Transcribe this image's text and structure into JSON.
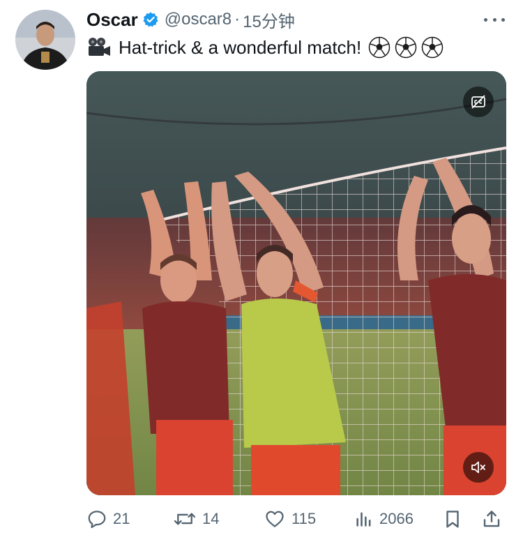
{
  "tweet": {
    "author_name": "Oscar",
    "handle": "@oscar8",
    "separator": "·",
    "time_ago": "15分钟",
    "text": "Hat-trick & a wonderful match!",
    "leading_emoji": "movie-camera-icon",
    "trailing_emoji": [
      "soccer-ball-icon",
      "soccer-ball-icon",
      "soccer-ball-icon"
    ]
  },
  "media": {
    "type": "video",
    "captions_icon": "captions-off-icon",
    "volume_icon": "muted-speaker-icon"
  },
  "actions": {
    "replies": "21",
    "reposts": "14",
    "likes": "115",
    "views": "2066",
    "bookmark_icon": "bookmark-icon",
    "share_icon": "share-icon"
  },
  "colors": {
    "verified": "#1d9bf0",
    "text_primary": "#0f1419",
    "text_secondary": "#536471"
  }
}
